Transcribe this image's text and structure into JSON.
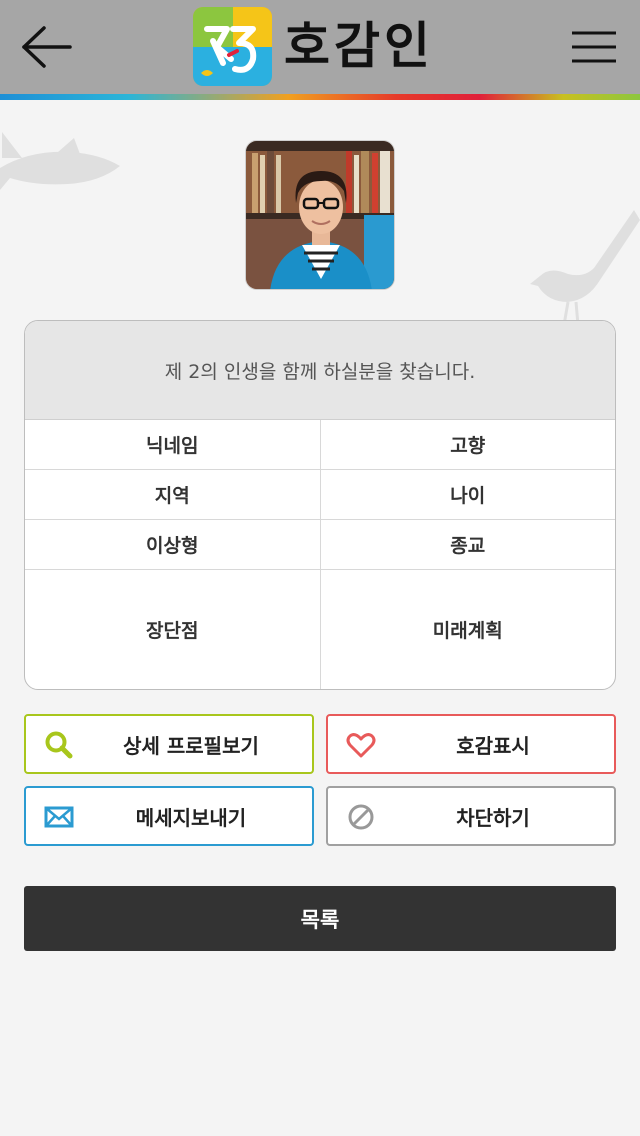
{
  "header": {
    "app_name": "호감인",
    "logo_icon": "hogamin-logo-icon",
    "back_icon": "back-arrow-icon",
    "menu_icon": "hamburger-menu-icon"
  },
  "profile": {
    "avatar_icon": "profile-photo",
    "intro": "제 2의 인생을 함께 하실분을 찾습니다.",
    "fields": [
      [
        "닉네임",
        "고향"
      ],
      [
        "지역",
        "나이"
      ],
      [
        "이상형",
        "종교"
      ],
      [
        "장단점",
        "미래계획"
      ]
    ]
  },
  "actions": {
    "view_profile": "상세 프로필보기",
    "like": "호감표시",
    "message": "메세지보내기",
    "block": "차단하기"
  },
  "list_button": "목록",
  "colors": {
    "header_bg": "#a6a6a6",
    "profile_btn": "#a8c61c",
    "like_btn": "#e85a5a",
    "message_btn": "#2b9bd1",
    "block_btn": "#a0a0a0",
    "list_btn": "#333333"
  }
}
